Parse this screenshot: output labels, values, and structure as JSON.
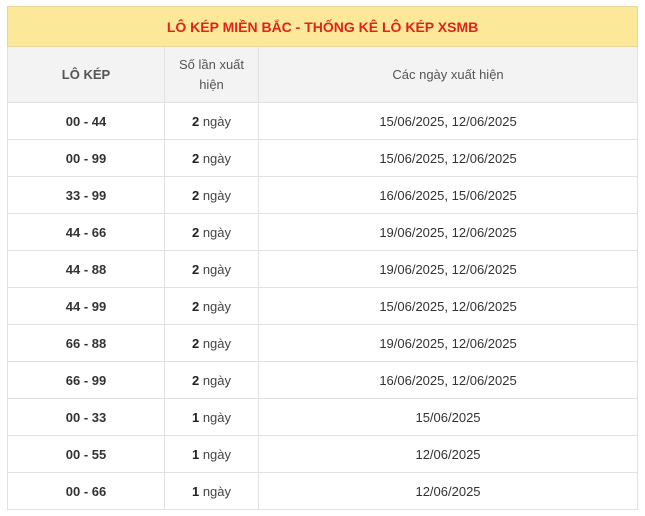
{
  "title": "LÔ KÉP MIỀN BẮC - THỐNG KÊ LÔ KÉP XSMB",
  "headers": {
    "pair": "LÔ KÉP",
    "count": "Số lần xuất hiện",
    "dates": "Các ngày xuất hiện"
  },
  "unit": "ngày",
  "rows": [
    {
      "pair": "00 - 44",
      "count": "2",
      "unit": "ngày",
      "date1": "15/06/2025",
      "sep": ",",
      "date2": "12/06/2025"
    },
    {
      "pair": "00 - 99",
      "count": "2",
      "unit": "ngày",
      "date1": "15/06/2025",
      "sep": ",",
      "date2": "12/06/2025"
    },
    {
      "pair": "33 - 99",
      "count": "2",
      "unit": "ngày",
      "date1": "16/06/2025",
      "sep": ",",
      "date2": "15/06/2025"
    },
    {
      "pair": "44 - 66",
      "count": "2",
      "unit": "ngày",
      "date1": "19/06/2025",
      "sep": ",",
      "date2": "12/06/2025"
    },
    {
      "pair": "44 - 88",
      "count": "2",
      "unit": "ngày",
      "date1": "19/06/2025",
      "sep": ",",
      "date2": "12/06/2025"
    },
    {
      "pair": "44 - 99",
      "count": "2",
      "unit": "ngày",
      "date1": "15/06/2025",
      "sep": ",",
      "date2": "12/06/2025"
    },
    {
      "pair": "66 - 88",
      "count": "2",
      "unit": "ngày",
      "date1": "19/06/2025",
      "sep": ",",
      "date2": "12/06/2025"
    },
    {
      "pair": "66 - 99",
      "count": "2",
      "unit": "ngày",
      "date1": "16/06/2025",
      "sep": ",",
      "date2": "12/06/2025"
    },
    {
      "pair": "00 - 33",
      "count": "1",
      "unit": "ngày",
      "date1": "15/06/2025",
      "sep": "",
      "date2": ""
    },
    {
      "pair": "00 - 55",
      "count": "1",
      "unit": "ngày",
      "date1": "12/06/2025",
      "sep": "",
      "date2": ""
    },
    {
      "pair": "00 - 66",
      "count": "1",
      "unit": "ngày",
      "date1": "12/06/2025",
      "sep": "",
      "date2": ""
    }
  ],
  "colors": {
    "title_bg": "#fbe899",
    "title_text": "#e0241b",
    "header_bg": "#f3f3f3",
    "date_link": "#1b3fa8"
  }
}
